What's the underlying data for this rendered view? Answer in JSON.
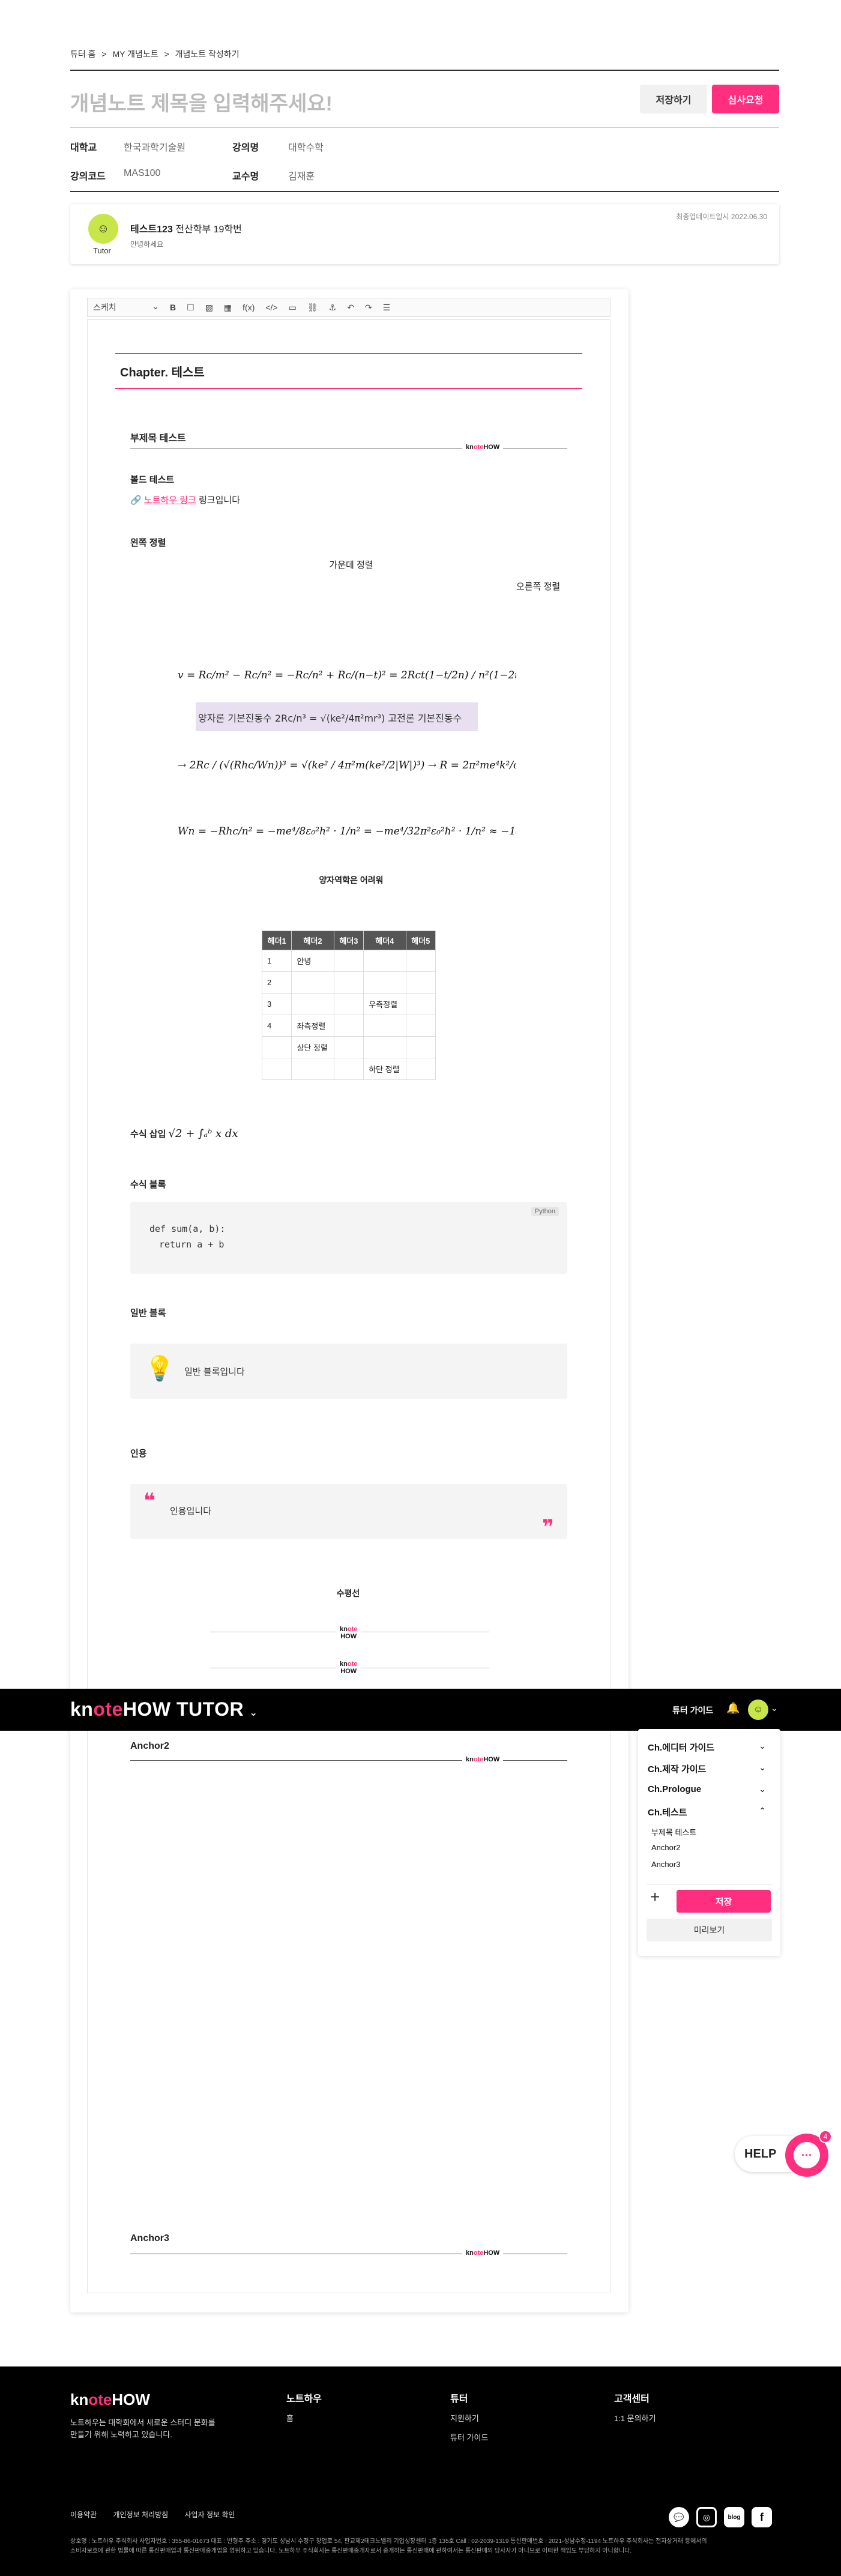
{
  "breadcrumb": [
    "튜터 홈",
    ">",
    "MY 개념노트",
    ">",
    "개념노트 작성하기"
  ],
  "title_placeholder": "개념노트 제목을 입력해주세요!",
  "buttons": {
    "save": "저장하기",
    "review": "심사요청"
  },
  "meta": {
    "univ_label": "대학교",
    "univ_value": "한국과학기술원",
    "lecture_label": "강의명",
    "lecture_value": "대학수학",
    "code_label": "강의코드",
    "code_value": "MAS100",
    "prof_label": "교수명",
    "prof_value": "김재훈"
  },
  "tutor": {
    "name": "테스트123",
    "dept": "전산학부 19학번",
    "greeting": "안녕하세요",
    "tag": "Tutor",
    "updated": "최종업데이트일시 2022.06.30"
  },
  "toolbar": {
    "style": "스케치",
    "bold": "B",
    "underline": "I",
    "func": "f(x)",
    "code": "</>"
  },
  "editor": {
    "chapter": "Chapter. 테스트",
    "subhead1": "부제목 테스트",
    "bold_test": "볼드 테스트",
    "link_text": "노트하우 링크",
    "link_suffix": " 링크입니다",
    "align_left": "왼쪽 정렬",
    "align_center": "가운데 정렬",
    "align_right": "오른쪽 정렬",
    "eq_caption": "양자역학은 어려워",
    "formula_inline_label": "수식 삽입",
    "code_block_label": "수식 블록",
    "code_lang": "Python",
    "code_line1": "def sum(a, b):",
    "code_line2": "return a + b",
    "plain_block_label": "일반 블록",
    "plain_block_text": "일반 블록입니다",
    "quote_label": "인용",
    "quote_text": "인용입니다",
    "hr_label": "수평선",
    "anchor2": "Anchor2",
    "anchor3": "Anchor3",
    "logo_text": "knoteHOW"
  },
  "table": {
    "headers": [
      "헤더1",
      "헤더2",
      "헤더3",
      "헤더4",
      "헤더5"
    ],
    "rows": [
      [
        "1",
        "안녕",
        "",
        "",
        ""
      ],
      [
        "2",
        "",
        "",
        "",
        ""
      ],
      [
        "3",
        "",
        "",
        "우측정렬",
        ""
      ],
      [
        "4",
        "좌측정렬",
        "",
        "",
        ""
      ],
      [
        "",
        "상단 정렬",
        "",
        "",
        ""
      ],
      [
        "",
        "",
        "",
        "하단 정렬",
        ""
      ]
    ]
  },
  "topbar": {
    "brand_pre": "kn",
    "brand_mid": "ote",
    "brand_post": "HOW TUTOR",
    "guide": "튜터 가이드"
  },
  "sidebar": {
    "items": [
      "Ch.에디터 가이드",
      "Ch.제작 가이드",
      "Ch.Prologue",
      "Ch.테스트"
    ],
    "subs": [
      "부제목 테스트",
      "Anchor2",
      "Anchor3"
    ],
    "save": "저장",
    "preview": "미리보기"
  },
  "help": {
    "label": "HELP",
    "count": "4"
  },
  "footer": {
    "brand": "knoteHOW",
    "desc1": "노트하우는 대학회에서 새로운 스터디 문화를",
    "desc2": "만들기 위해 노력하고 있습니다.",
    "col1_h": "노트하우",
    "col1_items": [
      "홈"
    ],
    "col2_h": "튜터",
    "col2_items": [
      "지원하기",
      "튜터 가이드"
    ],
    "col3_h": "고객센터",
    "col3_items": [
      "1:1 문의하기"
    ],
    "links": [
      "이용약관",
      "개인정보 처리방침",
      "사업자 정보 확인"
    ],
    "biz1": "상호명 : 노트하우 주식회사 사업자번호 : 355-86-01673 대표 : 반형주 주소 : 경기도 성남시 수정구 창업로 54, 판교제2테크노밸리 기업성장센터 1층 135호 Call : 02-2039-1319 통신판매번호 : 2021-성남수정-1194 노트하우 주식회사는 전자상거래 등에서의",
    "biz2": "소비자보호에 관한 법률에 따른 통신판매업과 통신판매중개업을 영위하고 있습니다. 노트하우 주식회사는 통신판매중개자로서 중개하는 통신판매에 관하여서는 통신판매의 당사자가 아니므로 어떠한 책임도 부담하지 아니합니다."
  }
}
